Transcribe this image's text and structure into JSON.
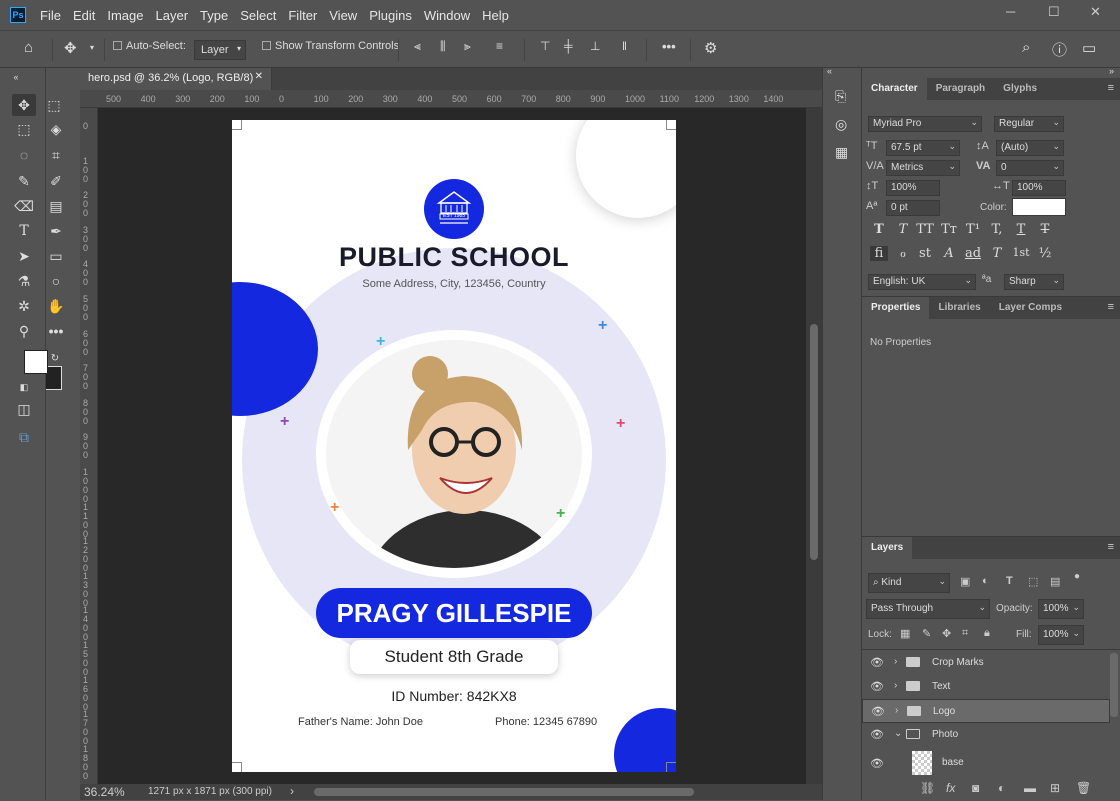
{
  "app": {
    "logo": "Ps"
  },
  "menu": [
    "File",
    "Edit",
    "Image",
    "Layer",
    "Type",
    "Select",
    "Filter",
    "View",
    "Plugins",
    "Window",
    "Help"
  ],
  "options_bar": {
    "auto_select_label": "Auto-Select:",
    "auto_select_value": "Layer",
    "show_transform_label": "Show Transform Controls",
    "more_label": "•••"
  },
  "document": {
    "tab_title": "hero.psd @ 36.2% (Logo, RGB/8)",
    "zoom": "36.24%",
    "doc_info": "1271 px x 1871 px (300 ppi)",
    "status_arrow": "›"
  },
  "ruler_top": [
    "500",
    "400",
    "300",
    "200",
    "100",
    "0",
    "100",
    "200",
    "300",
    "400",
    "500",
    "600",
    "700",
    "800",
    "900",
    "1000",
    "1100",
    "1200",
    "1300",
    "1400"
  ],
  "ruler_left": [
    "0",
    "1 0 0",
    "2 0 0",
    "3 0 0",
    "4 0 0",
    "5 0 0",
    "6 0 0",
    "7 0 0",
    "8 0 0",
    "9 0 0",
    "1 0 0 0",
    "1 1 0 0",
    "1 2 0 0",
    "1 3 0 0",
    "1 4 0 0",
    "1 5 0 0",
    "1 6 0 0",
    "1 7 0 0",
    "1 8 0 0"
  ],
  "card": {
    "logo_text": "EST 1985",
    "school_name": "PUBLIC SCHOOL",
    "address": "Some Address, City, 123456, Country",
    "student_name": "PRAGY GILLESPIE",
    "grade": "Student 8th Grade",
    "id_number": "ID Number: 842KX8",
    "father": "Father's Name: John Doe",
    "phone": "Phone: 12345 67890",
    "accent_color": "#1428e0"
  },
  "character_panel": {
    "tabs": [
      "Character",
      "Paragraph",
      "Glyphs"
    ],
    "font_family": "Myriad Pro",
    "font_style": "Regular",
    "font_size": "67.5 pt",
    "leading": "(Auto)",
    "kerning": "Metrics",
    "tracking": "0",
    "vertical_scale": "100%",
    "horizontal_scale": "100%",
    "baseline_shift": "0 pt",
    "color_label": "Color:",
    "color_value": "#ffffff",
    "type_buttons": [
      "T",
      "T",
      "TT",
      "Tт",
      "T¹",
      "T,",
      "T",
      "T"
    ],
    "feature_buttons": [
      "ﬁ",
      "ℴ",
      "st",
      "A",
      "ad",
      "T",
      "1st",
      "½"
    ],
    "language": "English: UK",
    "antialias_icon": "ªa",
    "antialias": "Sharp"
  },
  "properties_panel": {
    "tabs": [
      "Properties",
      "Libraries",
      "Layer Comps"
    ],
    "empty_text": "No Properties"
  },
  "layers_panel": {
    "title": "Layers",
    "kind_label": "Kind",
    "blend_mode": "Pass Through",
    "opacity_label": "Opacity:",
    "opacity": "100%",
    "lock_label": "Lock:",
    "fill_label": "Fill:",
    "fill": "100%",
    "layers": [
      {
        "name": "Crop Marks",
        "type": "group",
        "selected": false
      },
      {
        "name": "Text",
        "type": "group",
        "selected": false
      },
      {
        "name": "Logo",
        "type": "group",
        "selected": true
      },
      {
        "name": "Photo",
        "type": "group-open",
        "selected": false
      },
      {
        "name": "base",
        "type": "layer",
        "selected": false
      }
    ]
  }
}
